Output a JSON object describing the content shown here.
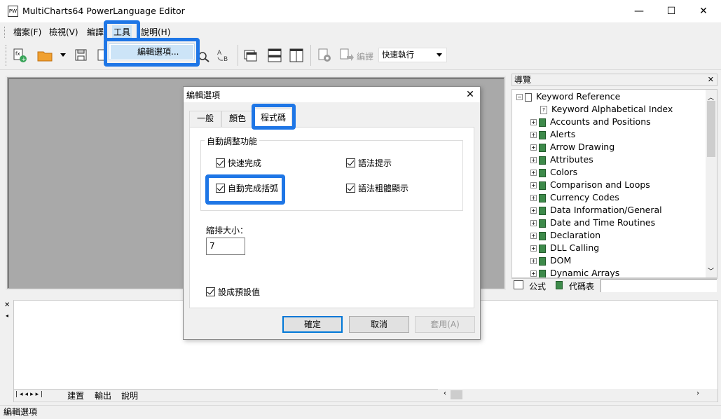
{
  "window": {
    "title": "MultiCharts64 PowerLanguage Editor",
    "app_icon_text": "PW",
    "minimize_glyph": "—",
    "maximize_glyph": "☐",
    "close_glyph": "✕"
  },
  "menubar": {
    "items": [
      {
        "label": "檔案(F)"
      },
      {
        "label": "檢視(V)"
      },
      {
        "label": "編譯"
      },
      {
        "label": "工具"
      },
      {
        "label": "說明(H)"
      }
    ]
  },
  "tools_menu": {
    "items": [
      {
        "label": "編輯選項..."
      }
    ]
  },
  "toolbar": {
    "compile_label": "編譯",
    "run_mode_value": "快速執行"
  },
  "navigator": {
    "title": "導覽",
    "close_glyph": "✕",
    "tree": [
      {
        "label": "Keyword Reference",
        "kind": "root"
      },
      {
        "label": "Keyword Alphabetical Index",
        "kind": "page"
      },
      {
        "label": "Accounts and Positions",
        "kind": "book"
      },
      {
        "label": "Alerts",
        "kind": "book"
      },
      {
        "label": "Arrow Drawing",
        "kind": "book"
      },
      {
        "label": "Attributes",
        "kind": "book"
      },
      {
        "label": "Colors",
        "kind": "book"
      },
      {
        "label": "Comparison and Loops",
        "kind": "book"
      },
      {
        "label": "Currency Codes",
        "kind": "book"
      },
      {
        "label": "Data Information/General",
        "kind": "book"
      },
      {
        "label": "Date and Time Routines",
        "kind": "book"
      },
      {
        "label": "Declaration",
        "kind": "book"
      },
      {
        "label": "DLL Calling",
        "kind": "book"
      },
      {
        "label": "DOM",
        "kind": "book"
      },
      {
        "label": "Dynamic Arrays",
        "kind": "book"
      }
    ],
    "tabs": [
      {
        "label": "公式"
      },
      {
        "label": "代碼表"
      }
    ]
  },
  "output": {
    "close_glyph": "✕",
    "tabs": [
      {
        "label": "建置"
      },
      {
        "label": "輸出"
      },
      {
        "label": "說明"
      }
    ]
  },
  "statusbar": {
    "text": "編輯選項"
  },
  "dialog": {
    "title": "編輯選項",
    "close_glyph": "✕",
    "tabs": [
      {
        "label": "一般",
        "active": false
      },
      {
        "label": "顏色",
        "active": false
      },
      {
        "label": "程式碼",
        "active": true
      }
    ],
    "group_title": "自動調整功能",
    "checkboxes": {
      "quick_complete": {
        "label": "快速完成",
        "checked": true
      },
      "syntax_hint": {
        "label": "語法提示",
        "checked": true
      },
      "auto_brackets": {
        "label": "自動完成括弧",
        "checked": true
      },
      "syntax_bold": {
        "label": "語法粗體顯示",
        "checked": true
      },
      "set_default": {
        "label": "設成預設值",
        "checked": true
      }
    },
    "indent_label": "縮排大小：",
    "indent_value": "7",
    "buttons": {
      "ok": "確定",
      "cancel": "取消",
      "apply": "套用(A)"
    }
  },
  "colors": {
    "highlight": "#1e76e6",
    "menu_hover": "#cce4f7",
    "book_icon": "#3d8a4a"
  }
}
